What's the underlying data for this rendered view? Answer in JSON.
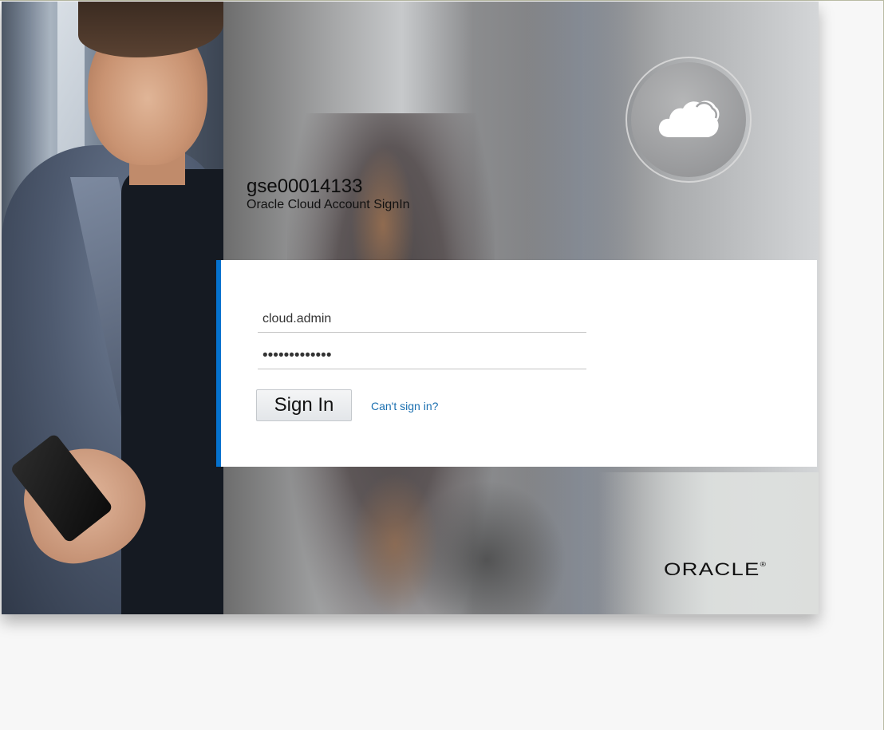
{
  "account": {
    "identity_domain": "gse00014133",
    "subtitle": "Oracle Cloud Account SignIn"
  },
  "form": {
    "username_value": "cloud.admin",
    "password_value": "•••••••••••••",
    "signin_label": "Sign In",
    "cant_signin_label": "Can't sign in?"
  },
  "brand": {
    "logo_text": "ORACLE",
    "registered_mark": "®",
    "accent_color": "#0572ce",
    "link_color": "#1a6fb0"
  },
  "icons": {
    "cloud": "cloud-icon"
  }
}
